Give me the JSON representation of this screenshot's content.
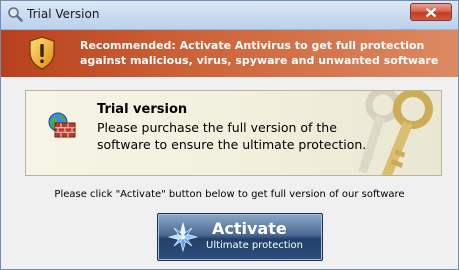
{
  "window": {
    "title": "Trial Version"
  },
  "banner": {
    "line1": "Recommended: Activate Antivirus to get full protection",
    "line2": "against malicious, virus, spyware and unwanted software"
  },
  "panel": {
    "title": "Trial version",
    "line1": "Please purchase the full version of the",
    "line2": "software to ensure the ultimate protection."
  },
  "instruction": "Please click \"Activate\" button below to get full version of our software",
  "activate": {
    "label": "Activate",
    "sublabel": "Ultimate protection"
  },
  "icons": {
    "title": "magnifier-icon",
    "close": "close-icon",
    "shield": "shield-warning-icon",
    "panel": "firewall-globe-icon",
    "keys": "keys-icon",
    "activate": "star-icon"
  },
  "colors": {
    "banner": "#c1522b",
    "panel_bg": "#f3f1e2",
    "button": "#2d4f7c"
  }
}
